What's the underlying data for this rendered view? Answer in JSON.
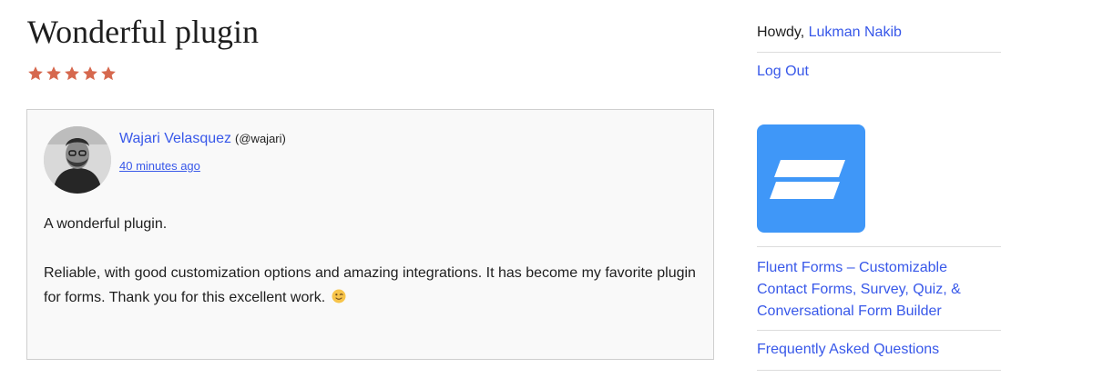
{
  "review": {
    "title": "Wonderful plugin",
    "rating": 5,
    "rating_max": 5,
    "star_color": "#d6684e",
    "reviewer_name": "Wajari Velasquez",
    "reviewer_handle": "(@wajari)",
    "posted_time": "40 minutes ago",
    "paragraphs": [
      "A wonderful plugin.",
      "Reliable, with good customization options and amazing integrations. It has become my favorite plugin for forms. Thank you for this excellent work."
    ],
    "emoji_icon": "winking-face-icon"
  },
  "sidebar": {
    "greeting": "Howdy,",
    "user_name": "Lukman Nakib",
    "logout_label": "Log Out",
    "plugin_icon": "fluent-forms-logo",
    "plugin_icon_color": "#3f97f8",
    "plugin_name": "Fluent Forms – Customizable Contact Forms, Survey, Quiz, & Conversational Form Builder",
    "faq_label": "Frequently Asked Questions"
  },
  "colors": {
    "link": "#3858e9",
    "text": "#1e1e1e",
    "card_background": "#f9f9f9"
  }
}
